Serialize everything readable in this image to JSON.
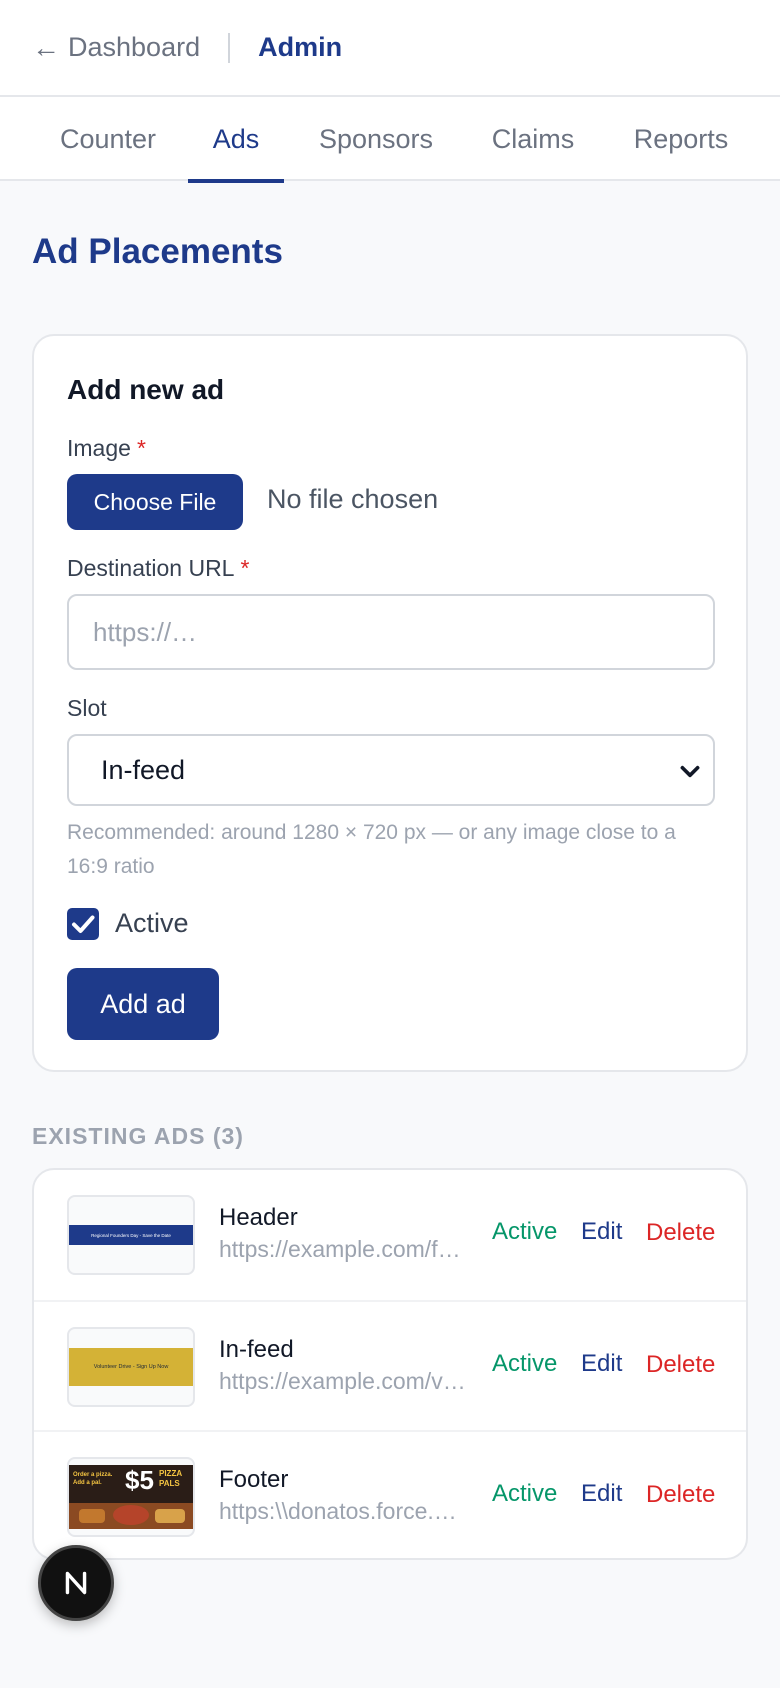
{
  "header": {
    "back_arrow": "←",
    "back_label": "Dashboard",
    "section": "Admin"
  },
  "tabs": [
    {
      "label": "Counter",
      "active": false
    },
    {
      "label": "Ads",
      "active": true
    },
    {
      "label": "Sponsors",
      "active": false
    },
    {
      "label": "Claims",
      "active": false
    },
    {
      "label": "Reports",
      "active": false
    }
  ],
  "page": {
    "title": "Ad Placements"
  },
  "form": {
    "title": "Add new ad",
    "image_label": "Image",
    "required_mark": "*",
    "file_button": "Choose File",
    "file_status": "No file chosen",
    "url_label": "Destination URL",
    "url_placeholder": "https://…",
    "url_value": "",
    "slot_label": "Slot",
    "slot_value": "In-feed",
    "hint": "Recommended: around 1280 × 720 px — or any image close to a 16:9 ratio",
    "active_label": "Active",
    "active_checked": true,
    "submit_label": "Add ad"
  },
  "existing": {
    "heading": "EXISTING ADS (3)",
    "edit_label": "Edit",
    "delete_label": "Delete",
    "ads": [
      {
        "slot": "Header",
        "url": "https://example.com/founders-day",
        "status": "Active",
        "thumb_text": "Regional Founders Day - Save the Date",
        "thumb_color": "#1e3a8a"
      },
      {
        "slot": "In-feed",
        "url": "https://example.com/volunteer",
        "status": "Active",
        "thumb_text": "Volunteer Drive - Sign Up Now",
        "thumb_color": "#d4b236"
      },
      {
        "slot": "Footer",
        "url": "https:\\\\donatos.force.com",
        "status": "Active",
        "thumb_text_1": "Order a pizza.",
        "thumb_text_2": "Add a pal.",
        "thumb_price": "$5",
        "thumb_brand_1": "PIZZA",
        "thumb_brand_2": "PALS"
      }
    ]
  },
  "colors": {
    "brand": "#1e3a8a",
    "active": "#059669",
    "danger": "#dc2626",
    "muted": "#9ca3af"
  },
  "icons": {
    "back": "left-arrow-icon",
    "select": "chevron-down-icon",
    "checkbox": "checkmark-icon",
    "fab": "n-logo-icon"
  }
}
